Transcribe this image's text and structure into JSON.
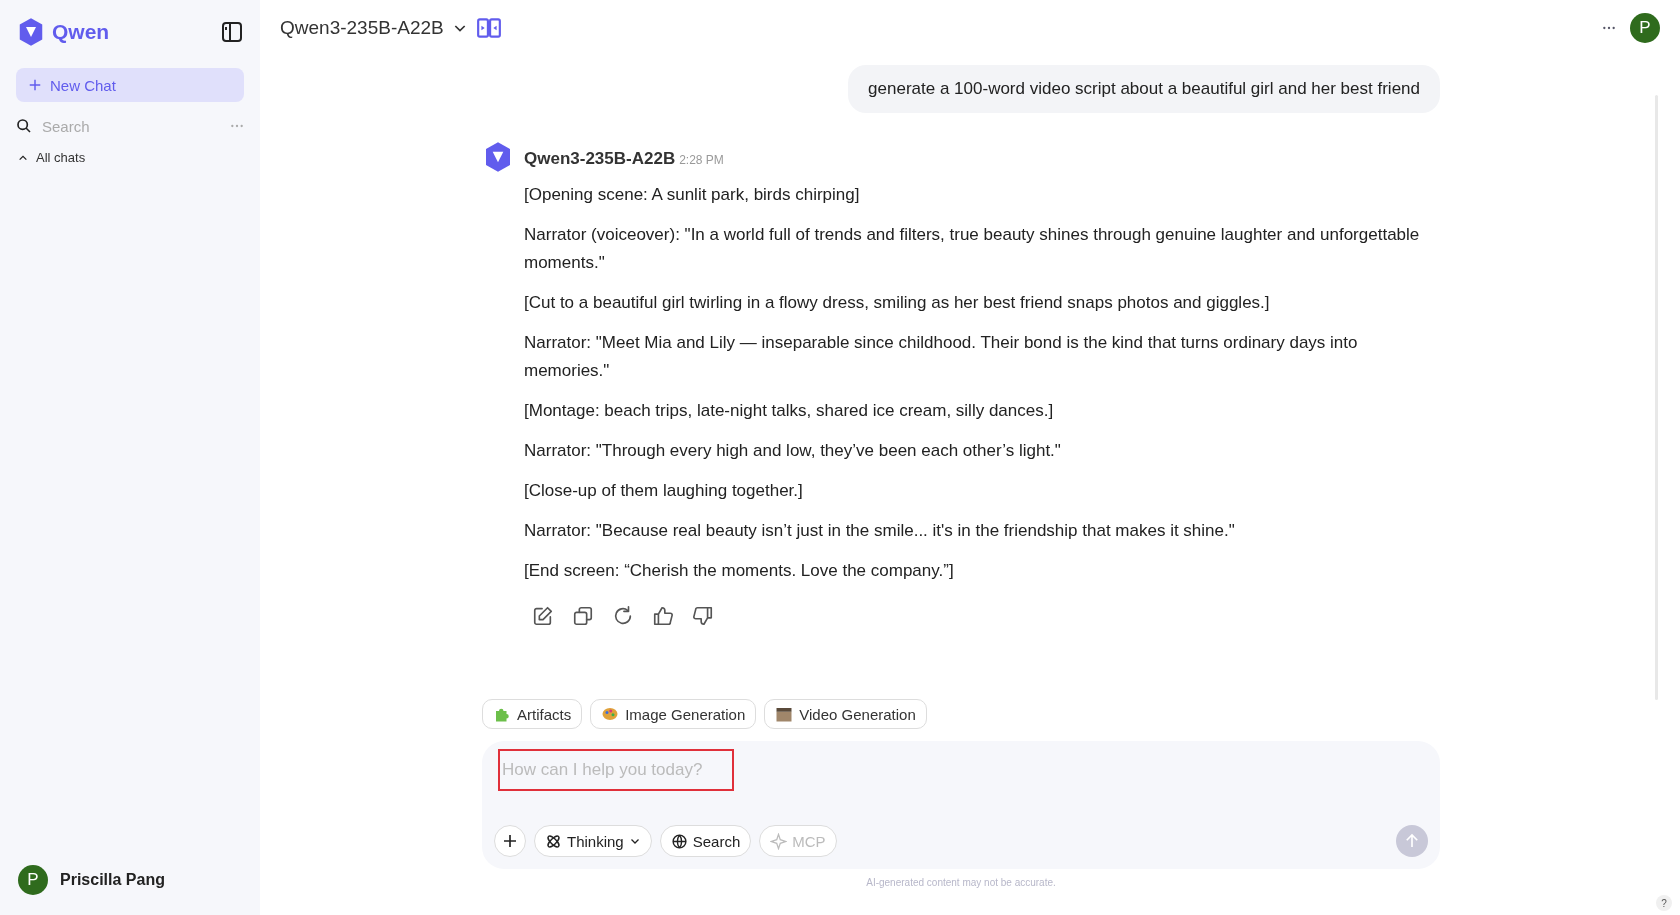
{
  "sidebar": {
    "brand": "Qwen",
    "new_chat": "New Chat",
    "search": {
      "placeholder": "Search"
    },
    "section": {
      "label": "All chats",
      "expanded": true
    },
    "user": {
      "initial": "P",
      "name": "Priscilla Pang"
    }
  },
  "header": {
    "model": "Qwen3-235B-A22B",
    "avatar": "P"
  },
  "user_message": "generate a 100-word video script about a beautiful girl and her best friend",
  "reply": {
    "model": "Qwen3-235B-A22B",
    "time": "2:28 PM",
    "paragraphs": [
      "[Opening scene: A sunlit park, birds chirping]",
      "Narrator (voiceover): \"In a world full of trends and filters, true beauty shines through genuine laughter and unforgettable moments.\"",
      "[Cut to a beautiful girl twirling in a flowy dress, smiling as her best friend snaps photos and giggles.]",
      "Narrator: \"Meet Mia and Lily — inseparable since childhood. Their bond is the kind that turns ordinary days into memories.\"",
      "[Montage: beach trips, late-night talks, shared ice cream, silly dances.]",
      "Narrator: \"Through every high and low, they’ve been each other’s light.\"",
      "[Close-up of them laughing together.]",
      "Narrator: \"Because real beauty isn’t just in the smile... it's in the friendship that makes it shine.\"",
      "[End screen: “Cherish the moments. Love the company.”]"
    ]
  },
  "chips": [
    {
      "label": "Artifacts",
      "kind": "puzzle"
    },
    {
      "label": "Image Generation",
      "kind": "palette"
    },
    {
      "label": "Video Generation",
      "kind": "film"
    }
  ],
  "composer": {
    "placeholder": "How can I help you today?",
    "tools": [
      {
        "label": "Thinking",
        "kind": "thinking",
        "disabled": false
      },
      {
        "label": "Search",
        "kind": "globe",
        "disabled": false
      },
      {
        "label": "MCP",
        "kind": "sparkle",
        "disabled": true
      }
    ]
  },
  "disclaimer": "AI-generated content may not be accurate.",
  "help": "?"
}
